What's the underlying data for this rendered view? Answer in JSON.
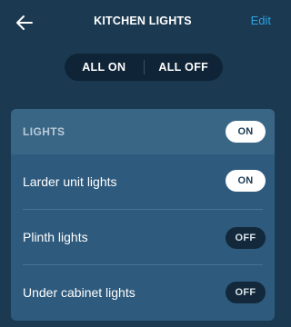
{
  "header": {
    "back_icon": "arrow-left-icon",
    "title": "KITCHEN LIGHTS",
    "edit_label": "Edit"
  },
  "group_controls": {
    "all_on_label": "ALL ON",
    "all_off_label": "ALL OFF"
  },
  "lights_group": {
    "label": "LIGHTS",
    "state": "ON",
    "items": [
      {
        "label": "Larder unit lights",
        "state": "ON"
      },
      {
        "label": "Plinth lights",
        "state": "OFF"
      },
      {
        "label": "Under cabinet lights",
        "state": "OFF"
      }
    ]
  },
  "colors": {
    "background": "#1b3a52",
    "accent": "#2aa3e0",
    "panel": "#2e5a7d",
    "panel_header": "#3a6686"
  }
}
